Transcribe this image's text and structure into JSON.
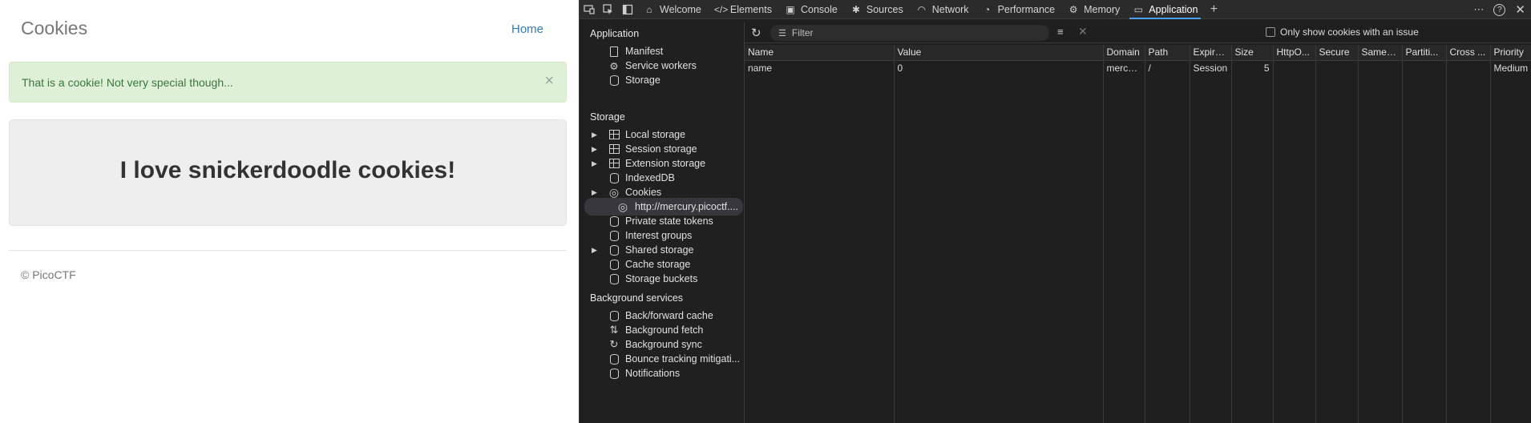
{
  "site": {
    "brand": "Cookies",
    "nav_home": "Home",
    "alert": "That is a cookie! Not very special though...",
    "alert_close": "×",
    "heading": "I love snickerdoodle cookies!",
    "footer": "© PicoCTF"
  },
  "devtools": {
    "tabs": [
      {
        "label": "Welcome",
        "icon": "home-icon"
      },
      {
        "label": "Elements",
        "icon": "code-icon"
      },
      {
        "label": "Console",
        "icon": "console-icon"
      },
      {
        "label": "Sources",
        "icon": "bug-icon"
      },
      {
        "label": "Network",
        "icon": "wifi-icon"
      },
      {
        "label": "Performance",
        "icon": "performance-icon"
      },
      {
        "label": "Memory",
        "icon": "gear-icon"
      },
      {
        "label": "Application",
        "icon": "application-icon",
        "active": true
      }
    ],
    "sidebar": {
      "application_title": "Application",
      "application_items": [
        "Manifest",
        "Service workers",
        "Storage"
      ],
      "storage_title": "Storage",
      "storage_items": [
        "Local storage",
        "Session storage",
        "Extension storage",
        "IndexedDB",
        "Cookies",
        "http://mercury.picoctf....",
        "Private state tokens",
        "Interest groups",
        "Shared storage",
        "Cache storage",
        "Storage buckets"
      ],
      "background_title": "Background services",
      "background_items": [
        "Back/forward cache",
        "Background fetch",
        "Background sync",
        "Bounce tracking mitigati...",
        "Notifications"
      ]
    },
    "toolbar": {
      "filter_placeholder": "Filter",
      "only_issues_label": "Only show cookies with an issue"
    },
    "table": {
      "columns": [
        "Name",
        "Value",
        "Domain",
        "Path",
        "Expire...",
        "Size",
        "HttpO...",
        "Secure",
        "SameS...",
        "Partiti...",
        "Cross ...",
        "Priority"
      ],
      "rows": [
        [
          "name",
          "0",
          "mercu...",
          "/",
          "Session",
          "5",
          "",
          "",
          "",
          "",
          "",
          "Medium"
        ]
      ]
    }
  }
}
